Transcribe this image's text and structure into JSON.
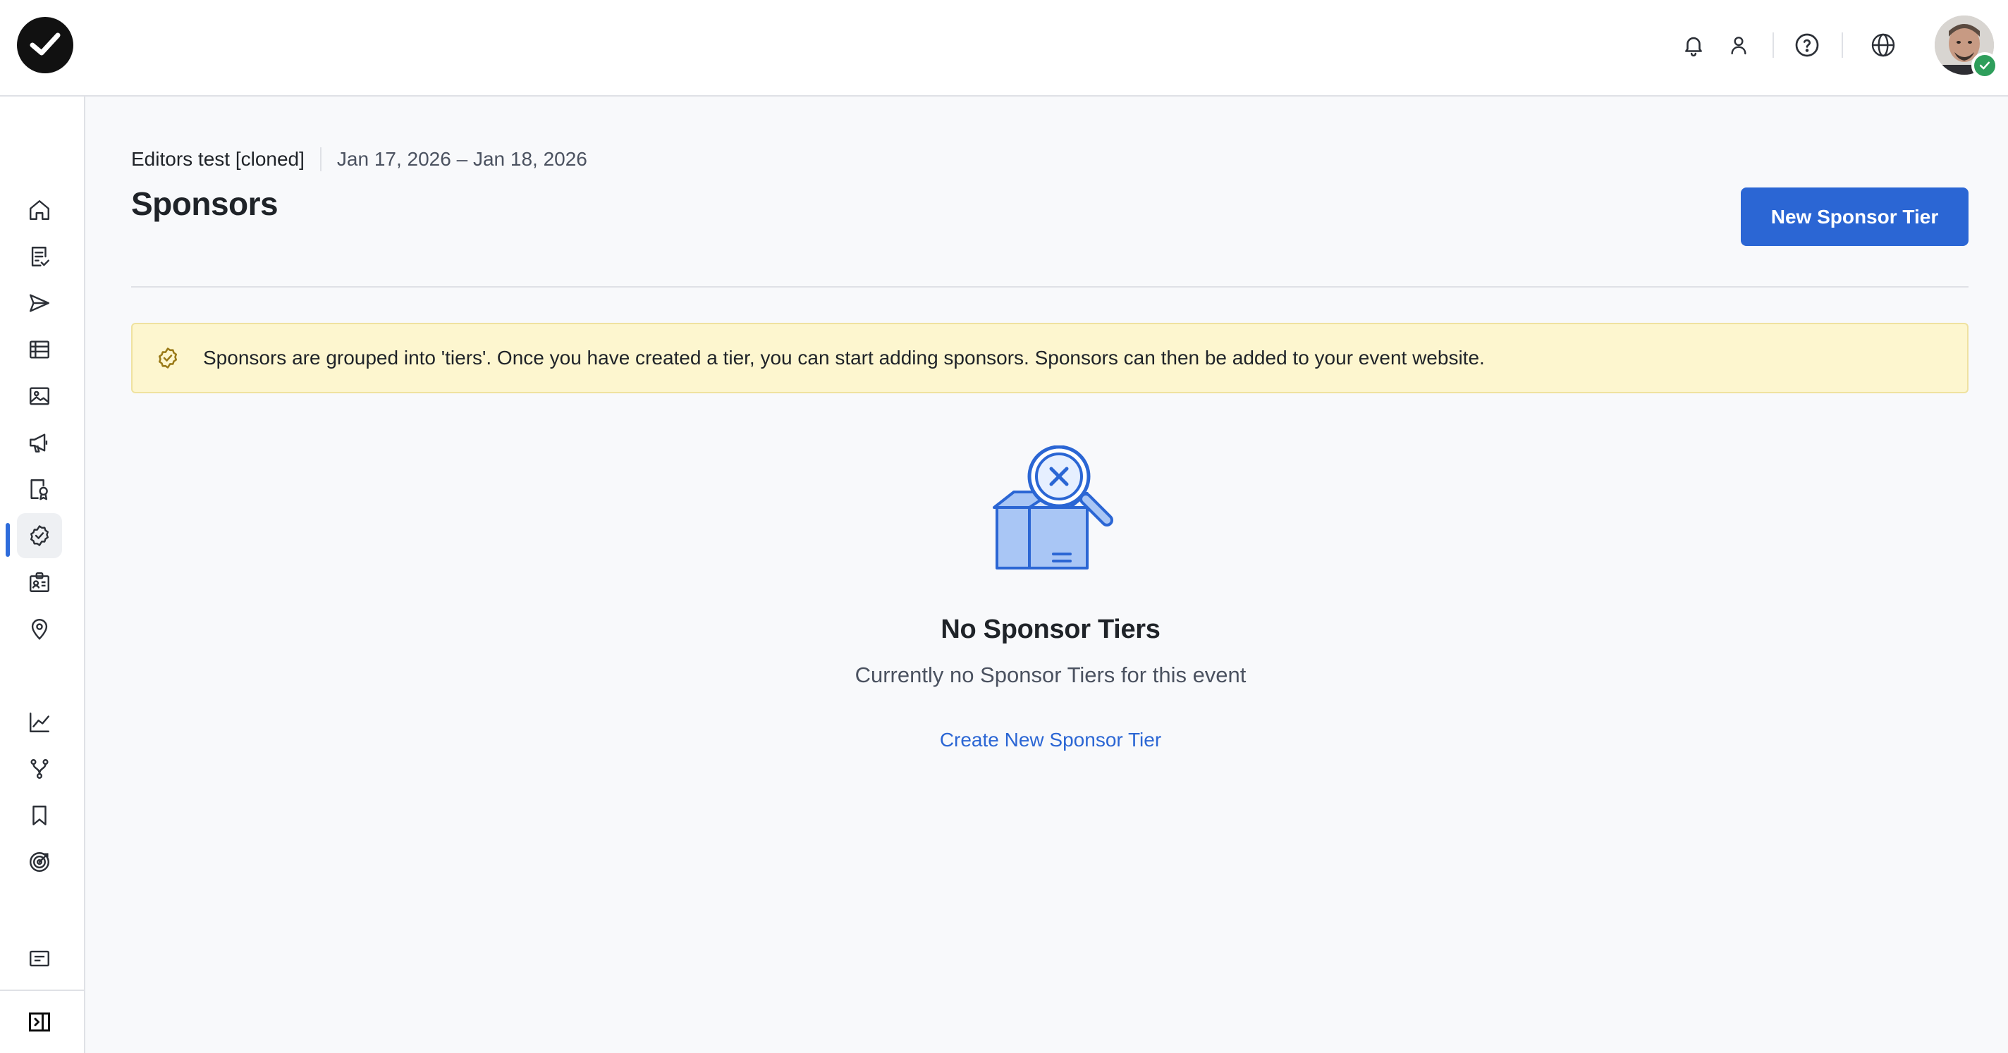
{
  "header": {
    "logo_icon": "check-logo-icon",
    "icons": [
      "bell-icon",
      "user-icon",
      "help-circle-icon",
      "globe-icon"
    ],
    "avatar_status_color": "#2e9e5b"
  },
  "sidebar": {
    "active_index": 7,
    "accent_color": "#2e6cdb",
    "items": [
      {
        "icon": "home-icon"
      },
      {
        "icon": "checklist-icon"
      },
      {
        "icon": "send-icon"
      },
      {
        "icon": "list-panel-icon"
      },
      {
        "icon": "image-icon"
      },
      {
        "icon": "megaphone-icon"
      },
      {
        "icon": "award-document-icon"
      },
      {
        "icon": "sponsor-badge-icon"
      },
      {
        "icon": "id-card-icon"
      },
      {
        "icon": "map-pin-icon"
      },
      {
        "icon": "chart-line-icon"
      },
      {
        "icon": "branch-icon"
      },
      {
        "icon": "bookmark-icon"
      },
      {
        "icon": "target-icon"
      },
      {
        "icon": "message-icon"
      },
      {
        "icon": "sidebar-toggle-icon"
      }
    ]
  },
  "main": {
    "event_name": "Editors test [cloned]",
    "event_dates": "Jan 17, 2026 – Jan 18, 2026",
    "page_title": "Sponsors",
    "primary_button_label": "New Sponsor Tier",
    "primary_color": "#2b66d4",
    "alert": {
      "text": "Sponsors are grouped into 'tiers'. Once you have created a tier, you can start adding sponsors. Sponsors can then be added to your event website.",
      "background": "#fdf6cf"
    },
    "empty_state": {
      "illustration": "empty-box-search-icon",
      "title": "No Sponsor Tiers",
      "subtitle": "Currently no Sponsor Tiers for this event",
      "link_label": "Create New Sponsor Tier"
    }
  }
}
